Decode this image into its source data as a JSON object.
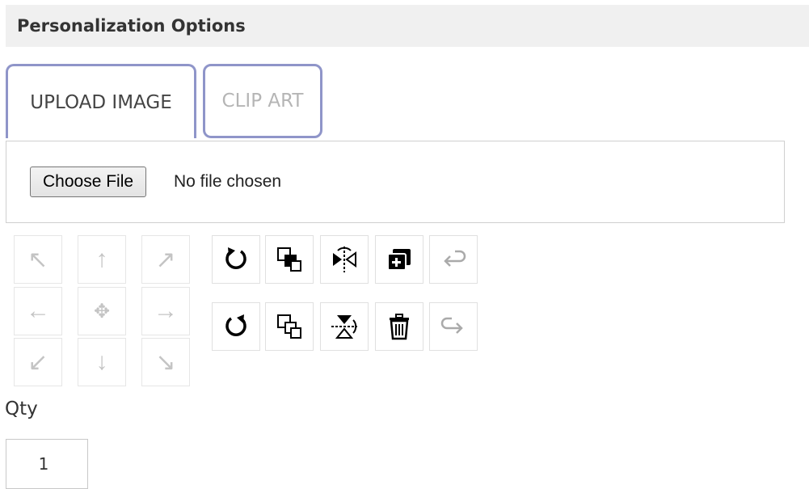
{
  "header": {
    "title": "Personalization Options"
  },
  "tabs": [
    {
      "label": "UPLOAD IMAGE",
      "active": true
    },
    {
      "label": "CLIP ART",
      "active": false
    }
  ],
  "upload": {
    "button_label": "Choose File",
    "status": "No file chosen"
  },
  "nav_pad": {
    "arrows": [
      "↖",
      "↑",
      "↗",
      "←",
      "✥",
      "→",
      "↙",
      "↓",
      "↘"
    ]
  },
  "toolbar": {
    "icons": [
      "rotate-clockwise-icon",
      "bring-forward-icon",
      "flip-horizontal-icon",
      "duplicate-layer-icon",
      "undo-icon",
      "rotate-counterclockwise-icon",
      "send-backward-icon",
      "flip-vertical-icon",
      "trash-icon",
      "redo-icon"
    ]
  },
  "qty": {
    "label": "Qty",
    "value": "1"
  },
  "colors": {
    "tab_border": "#8f95c9",
    "header_bg": "#f0f0f0",
    "disabled_arrow": "#c4c4c4"
  }
}
